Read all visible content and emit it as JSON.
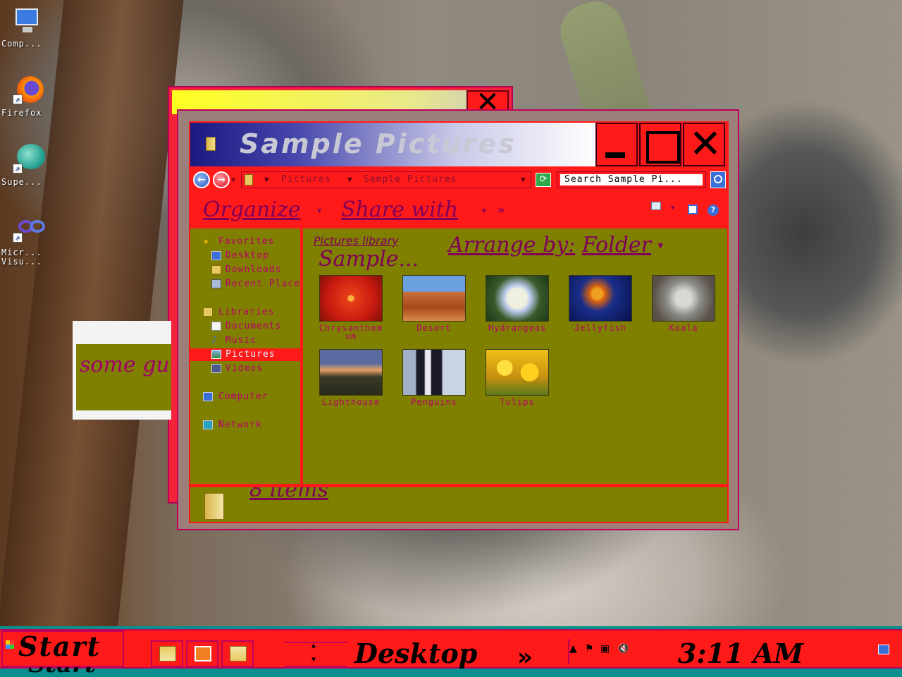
{
  "desktop_icons": [
    {
      "label": "Comp...",
      "icon": "computer-icon"
    },
    {
      "label": "Firefox",
      "icon": "firefox-icon"
    },
    {
      "label": "Supe...",
      "icon": "app-shortcut-icon"
    },
    {
      "label": "Micr...\nVisu...",
      "icon": "visual-studio-icon"
    }
  ],
  "small_window": {
    "text": "some gu"
  },
  "explorer": {
    "title": "Sample Pictures",
    "address": {
      "crumb_1": "Pictures",
      "crumb_2": "Sample Pictures"
    },
    "search_placeholder": "Search Sample Pi...",
    "commands": {
      "organize": "Organize",
      "share_with": "Share with",
      "more": "»"
    },
    "nav": [
      {
        "label": "Favorites",
        "icon": "star-icon"
      },
      {
        "label": "Desktop",
        "icon": "desktop-icon"
      },
      {
        "label": "Downloads",
        "icon": "downloads-icon"
      },
      {
        "label": "Recent Places",
        "icon": "recent-places-icon"
      },
      {
        "label": "Libraries",
        "icon": "libraries-icon"
      },
      {
        "label": "Documents",
        "icon": "documents-icon"
      },
      {
        "label": "Music",
        "icon": "music-icon"
      },
      {
        "label": "Pictures",
        "icon": "pictures-icon",
        "selected": true
      },
      {
        "label": "Videos",
        "icon": "videos-icon"
      },
      {
        "label": "Computer",
        "icon": "computer-icon"
      },
      {
        "label": "Network",
        "icon": "network-icon"
      }
    ],
    "library_label": "Pictures library",
    "library_title": "Sample...",
    "arrange_by_label": "Arrange by:",
    "arrange_by_value": "Folder",
    "items": [
      {
        "name": "Chrysanthemum",
        "color": "#d8281a"
      },
      {
        "name": "Desert",
        "color": "#b5582a"
      },
      {
        "name": "Hydrangeas",
        "color": "#7b9a5a"
      },
      {
        "name": "Jellyfish",
        "color": "#1a2e8a"
      },
      {
        "name": "Koala",
        "color": "#8a8a86"
      },
      {
        "name": "Lighthouse",
        "color": "#4a4a6a"
      },
      {
        "name": "Penguins",
        "color": "#9fb0c8"
      },
      {
        "name": "Tulips",
        "color": "#f0c018"
      }
    ],
    "status_count": "8 items"
  },
  "taskbar": {
    "start_label": "Start",
    "desktop_label": "Desktop",
    "desktop_chevron": "»",
    "clock": "3:11 AM"
  }
}
